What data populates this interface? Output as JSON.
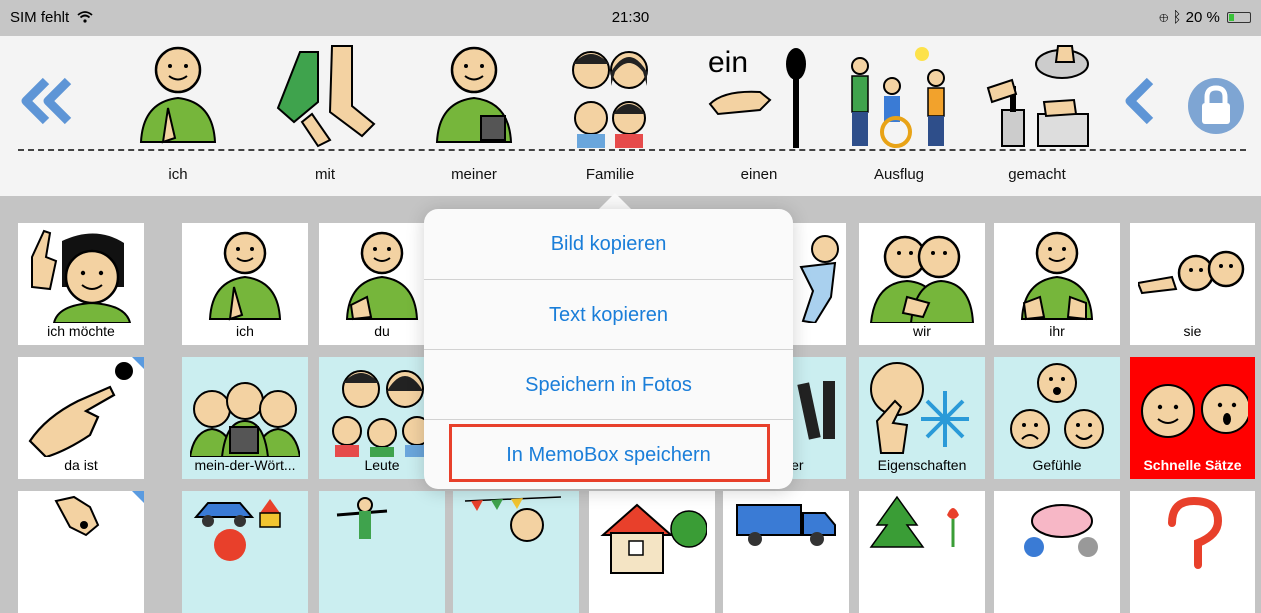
{
  "status": {
    "carrier": "SIM fehlt",
    "time": "21:30",
    "battery": "20 %"
  },
  "colors": {
    "accent": "#1a7ed9",
    "highlight": "#e8402b",
    "tile_cyan": "#cbeef0",
    "tile_red": "#ff0000",
    "lock": "#7ea5d3"
  },
  "sentence": {
    "words": [
      "ich",
      "mit",
      "meiner",
      "Familie",
      "einen",
      "Ausflug",
      "gemacht"
    ],
    "einen_symbol_text": "ein"
  },
  "grid": {
    "row1": [
      "ich möchte",
      "ich",
      "du",
      "",
      "",
      "",
      "wir",
      "ihr",
      "sie"
    ],
    "row2": [
      "da ist",
      "mein-der-Wört...",
      "Leute",
      "",
      "",
      "Vörter",
      "Eigenschaften",
      "Gefühle",
      "Schnelle Sätze"
    ]
  },
  "menu": {
    "items": [
      "Bild kopieren",
      "Text kopieren",
      "Speichern in Fotos",
      "In MemoBox speichern"
    ]
  },
  "icons": [
    "double-chevron-left-icon",
    "chevron-left-icon",
    "lock-icon",
    "wifi-icon",
    "bluetooth-icon",
    "battery-icon"
  ]
}
